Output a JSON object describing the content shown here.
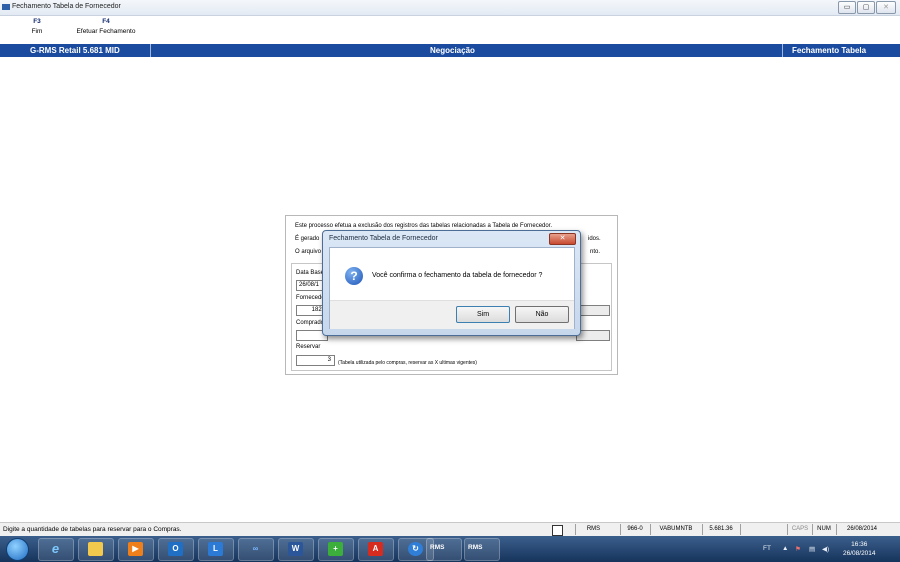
{
  "window": {
    "title": "Fechamento Tabela de Fornecedor",
    "controls": [
      "minimize-icon",
      "restore-icon",
      "close-icon"
    ]
  },
  "function_keys": [
    {
      "key": "F3",
      "label": "Fim"
    },
    {
      "key": "F4",
      "label": "Efetuar Fechamento"
    }
  ],
  "header": {
    "left": "G-RMS Retail 5.681 MID",
    "center": "Negociação",
    "right": "Fechamento Tabela"
  },
  "form": {
    "info_line1": "Este processo efetua a exclusão dos registros das tabelas relacionadas a Tabela de Fornecedor.",
    "info_line2_start": "É gerado",
    "info_line2_end": "idos.",
    "info_line3_start": "O arquivo",
    "info_line3_end": "nto.",
    "data_base_label": "Data Base",
    "data_base_value": "26/08/1",
    "fornecedor_label": "Fornecedor",
    "fornecedor_value": "1825",
    "comprador_label": "Comprador",
    "reservar_label": "Reservar",
    "reservar_value": "3",
    "reservar_hint": "(Tabela utilizada pelo compras, reservar as X ultimas vigentes)"
  },
  "dialog": {
    "title": "Fechamento Tabela de Fornecedor",
    "message": "Você confirma o fechamento da tabela de fornecedor ?",
    "yes": "Sim",
    "no": "Não",
    "icon": "question-icon"
  },
  "status_bar": {
    "message": "Digite a quantidade de tabelas para reservar para o Compras.",
    "cells": [
      "RMS",
      "966-0",
      "VABUMNTB",
      "5.681.36",
      "",
      "CAPS",
      "NUM",
      "26/08/2014"
    ]
  },
  "taskbar": {
    "apps": [
      "start-orb-icon",
      "internet-explorer-icon",
      "file-explorer-icon",
      "media-player-icon",
      "outlook-icon",
      "lync-icon",
      "infinity-icon",
      "word-icon",
      "app-installer-icon",
      "pdf-reader-icon",
      "remote-support-icon",
      "rms-app-icon",
      "rms-app-icon"
    ],
    "rms_label": "RMS",
    "tray_lang": "FT",
    "time": "16:36",
    "date": "26/08/2014"
  },
  "colors": {
    "header_blue": "#1a4b9e",
    "taskbar": "#1f4472"
  }
}
